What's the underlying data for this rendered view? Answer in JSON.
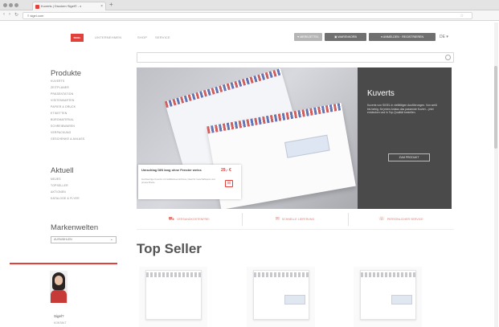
{
  "browser": {
    "tab_title": "Kuverts | Drucken Sigel© - x",
    "tab_close": "×",
    "new_tab": "+",
    "url": "≡ sigel.com",
    "nav_back": "‹",
    "nav_forward": "›",
    "nav_reload": "↻"
  },
  "header": {
    "logo_text": "SIGEL",
    "nav": [
      "UNTERNEHMEN",
      "SHOP",
      "SERVICE"
    ],
    "buttons": [
      "MERKZETTEL",
      "WARENKORB",
      "ANMELDEN · REGISTRIEREN"
    ],
    "lang": "DE ▾"
  },
  "search": {
    "placeholder": ""
  },
  "sidebar": {
    "produkte_heading": "Produkte",
    "produkte_items": [
      "KUVERTS",
      "ZEITPLANER",
      "PRÄSENTATION",
      "VISITENKARTEN",
      "PAPIER & DRUCK",
      "ETIKETTEN",
      "BÜROMATERIAL",
      "SCHREIBWAREN",
      "VERPACKUNG",
      "GESCHENKE & ANLASS"
    ],
    "aktuell_heading": "Aktuell",
    "aktuell_items": [
      "NEUES",
      "TOPSELLER",
      "AKTIONEN",
      "KATALOGE & FLYER"
    ],
    "markenwelten_heading": "Markenwelten",
    "markenwelten_select": "AUSWÄHLEN",
    "contact_question": "Sigel?",
    "contact_sub": "KONTAKT"
  },
  "hero": {
    "product_title": "Umschlag DIN lang ohne Fenster weiss",
    "product_desc": "Hochwertige Kuverts mit Haftklebeverschluss, ideal für Geschäftspost und private Briefe.",
    "product_price": "29,- €",
    "cart_icon": "⊞",
    "panel_heading": "Kuverts",
    "panel_text": "Kuverts von SIGEL in vielfältigen Ausführungen. Von weiß bis farbig, für jeden Anlass das passende Kuvert – jetzt entdecken und in Top-Qualität bestellen.",
    "panel_button": "ZUM PRODUKT"
  },
  "features": [
    {
      "icon": "⛟",
      "label": "VERSANDKOSTENFREI"
    },
    {
      "icon": "✉",
      "label": "SCHNELLE LIEFERUNG"
    },
    {
      "icon": "☏",
      "label": "PERSÖNLICHER SERVICE"
    }
  ],
  "topseller": {
    "heading": "Top Seller"
  },
  "colors": {
    "accent": "#e2403a",
    "dark_panel": "#4a4a4a"
  }
}
